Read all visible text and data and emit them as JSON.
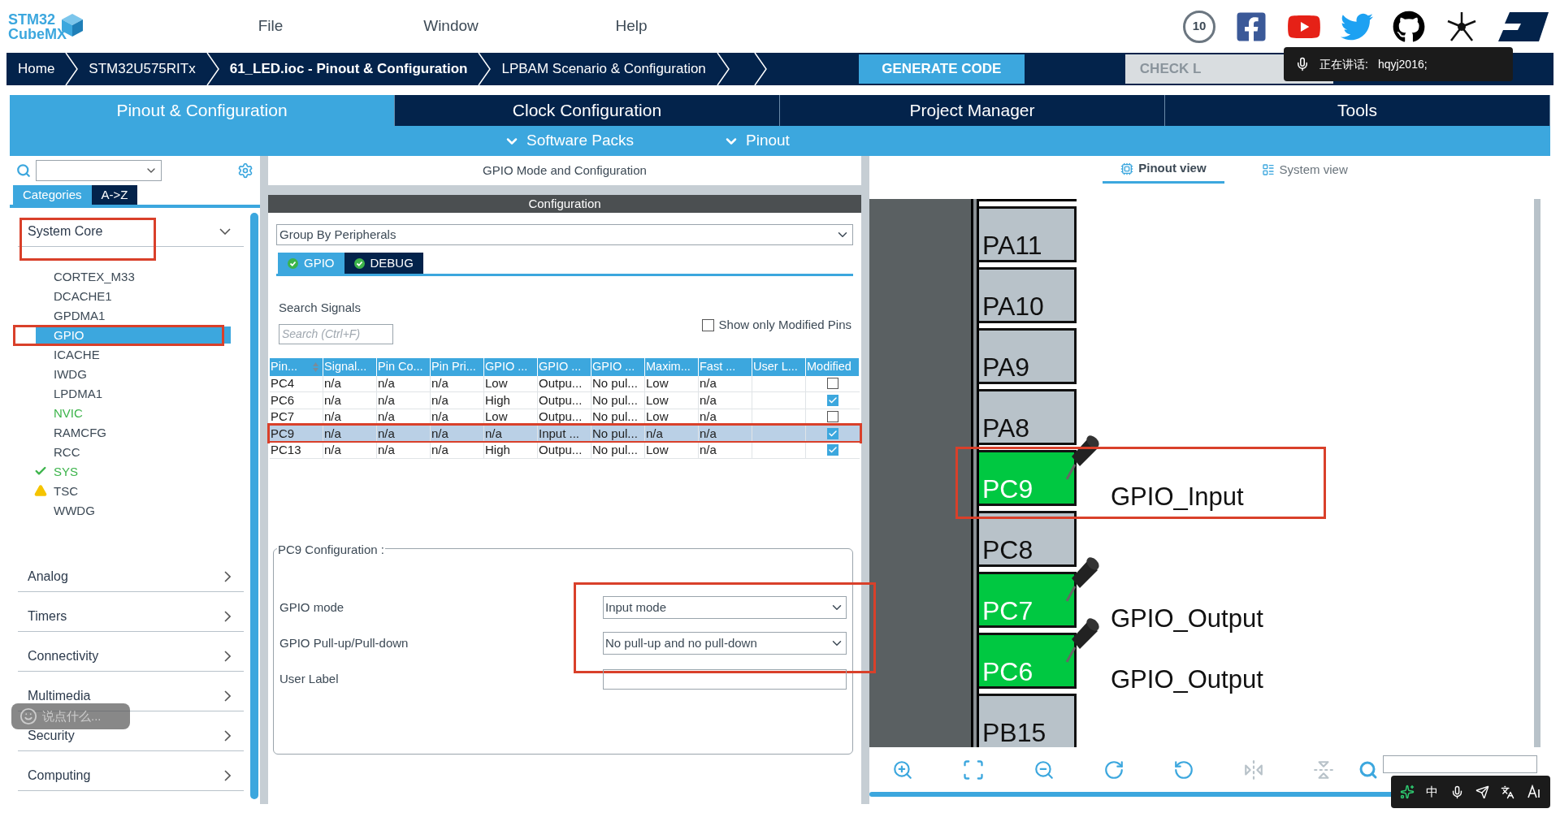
{
  "logo": {
    "line1": "STM32",
    "line2": "CubeMX"
  },
  "menu": [
    "File",
    "Window",
    "Help"
  ],
  "anniversary_badge": "10",
  "breadcrumbs": [
    {
      "label": "Home",
      "selected": false
    },
    {
      "label": "STM32U575RITx",
      "selected": false
    },
    {
      "label": "61_LED.ioc - Pinout & Configuration",
      "selected": true
    },
    {
      "label": "LPBAM Scenario & Configuration",
      "selected": false
    }
  ],
  "generate_button": "GENERATE CODE",
  "check_button": "CHECK L",
  "speaking_popup": {
    "label": "正在讲话:",
    "user": "hqyj2016;"
  },
  "main_tabs": [
    {
      "label": "Pinout & Configuration",
      "selected": true
    },
    {
      "label": "Clock Configuration",
      "selected": false
    },
    {
      "label": "Project Manager",
      "selected": false
    },
    {
      "label": "Tools",
      "selected": false
    }
  ],
  "sub_menus": [
    "Software Packs",
    "Pinout"
  ],
  "left_panel": {
    "tabs": [
      {
        "label": "Categories",
        "selected": true
      },
      {
        "label": "A->Z",
        "selected": false
      }
    ],
    "categories": [
      {
        "label": "System Core",
        "expanded": true,
        "highlighted": true,
        "children": [
          {
            "label": "CORTEX_M33",
            "kind": "plain",
            "selected": false,
            "highlighted": false
          },
          {
            "label": "DCACHE1",
            "kind": "plain",
            "selected": false,
            "highlighted": false
          },
          {
            "label": "GPDMA1",
            "kind": "plain",
            "selected": false,
            "highlighted": false
          },
          {
            "label": "GPIO",
            "kind": "plain",
            "selected": true,
            "highlighted": true
          },
          {
            "label": "ICACHE",
            "kind": "plain",
            "selected": false,
            "highlighted": false
          },
          {
            "label": "IWDG",
            "kind": "plain",
            "selected": false,
            "highlighted": false
          },
          {
            "label": "LPDMA1",
            "kind": "plain",
            "selected": false,
            "highlighted": false
          },
          {
            "label": "NVIC",
            "kind": "configured",
            "selected": false,
            "highlighted": false
          },
          {
            "label": "RAMCFG",
            "kind": "plain",
            "selected": false,
            "highlighted": false
          },
          {
            "label": "RCC",
            "kind": "plain",
            "selected": false,
            "highlighted": false
          },
          {
            "label": "SYS",
            "kind": "ok",
            "selected": false,
            "highlighted": false
          },
          {
            "label": "TSC",
            "kind": "warning",
            "selected": false,
            "highlighted": false
          },
          {
            "label": "WWDG",
            "kind": "plain",
            "selected": false,
            "highlighted": false
          }
        ]
      },
      {
        "label": "Analog",
        "expanded": false,
        "highlighted": false
      },
      {
        "label": "Timers",
        "expanded": false,
        "highlighted": false
      },
      {
        "label": "Connectivity",
        "expanded": false,
        "highlighted": false
      },
      {
        "label": "Multimedia",
        "expanded": false,
        "highlighted": false
      },
      {
        "label": "Security",
        "expanded": false,
        "highlighted": false
      },
      {
        "label": "Computing",
        "expanded": false,
        "highlighted": false
      }
    ]
  },
  "chat_bubble": {
    "placeholder": "说点什么..."
  },
  "middle_panel": {
    "title": "GPIO Mode and Configuration",
    "config_bar": "Configuration",
    "group_select": "Group By Peripherals",
    "tabs": [
      {
        "label": "GPIO",
        "selected": true
      },
      {
        "label": "DEBUG",
        "selected": false
      }
    ],
    "search_label": "Search Signals",
    "search": {
      "placeholder": "Search (Ctrl+F)"
    },
    "modified_only": {
      "label": "Show only Modified Pins",
      "checked": false
    },
    "table": {
      "columns": [
        {
          "label": "Pin...",
          "sorted": true
        },
        {
          "label": "Signal...",
          "sorted": false
        },
        {
          "label": "Pin Co...",
          "sorted": false
        },
        {
          "label": "Pin Pri...",
          "sorted": false
        },
        {
          "label": "GPIO ...",
          "sorted": false
        },
        {
          "label": "GPIO ...",
          "sorted": false
        },
        {
          "label": "GPIO ...",
          "sorted": false
        },
        {
          "label": "Maxim...",
          "sorted": false
        },
        {
          "label": "Fast ...",
          "sorted": false
        },
        {
          "label": "User L...",
          "sorted": false
        },
        {
          "label": "Modified",
          "sorted": false
        }
      ],
      "rows": [
        {
          "cells": [
            "PC4",
            "n/a",
            "n/a",
            "n/a",
            "Low",
            "Outpu...",
            "No pul...",
            "Low",
            "n/a",
            null
          ],
          "modified": false,
          "selected": false,
          "highlighted": false
        },
        {
          "cells": [
            "PC6",
            "n/a",
            "n/a",
            "n/a",
            "High",
            "Outpu...",
            "No pul...",
            "Low",
            "n/a",
            null
          ],
          "modified": true,
          "selected": false,
          "highlighted": false
        },
        {
          "cells": [
            "PC7",
            "n/a",
            "n/a",
            "n/a",
            "Low",
            "Outpu...",
            "No pul...",
            "Low",
            "n/a",
            null
          ],
          "modified": false,
          "selected": false,
          "highlighted": false
        },
        {
          "cells": [
            "PC9",
            "n/a",
            "n/a",
            "n/a",
            "n/a",
            "Input ...",
            "No pul...",
            "n/a",
            "n/a",
            null
          ],
          "modified": true,
          "selected": true,
          "highlighted": true
        },
        {
          "cells": [
            "PC13",
            "n/a",
            "n/a",
            "n/a",
            "High",
            "Outpu...",
            "No pul...",
            "Low",
            "n/a",
            null
          ],
          "modified": true,
          "selected": false,
          "highlighted": false
        }
      ]
    },
    "config": {
      "title": "PC9 Configuration :",
      "fields": [
        {
          "label": "GPIO mode",
          "kind": "select",
          "value": "Input mode",
          "highlighted": true
        },
        {
          "label": "GPIO Pull-up/Pull-down",
          "kind": "select",
          "value": "No pull-up and no pull-down",
          "highlighted": true
        },
        {
          "label": "User Label",
          "kind": "text",
          "highlighted": false
        }
      ]
    }
  },
  "right_panel": {
    "view_tabs": [
      {
        "label": "Pinout view",
        "selected": true
      },
      {
        "label": "System view",
        "selected": false
      }
    ],
    "pins": [
      {
        "label": "PA11",
        "active": false,
        "highlighted": false
      },
      {
        "label": "PA10",
        "active": false,
        "highlighted": false
      },
      {
        "label": "PA9",
        "active": false,
        "highlighted": false
      },
      {
        "label": "PA8",
        "active": false,
        "highlighted": false
      },
      {
        "label": "PC9",
        "active": true,
        "signal": "GPIO_Input",
        "highlighted": true
      },
      {
        "label": "PC8",
        "active": false,
        "highlighted": false
      },
      {
        "label": "PC7",
        "active": true,
        "signal": "GPIO_Output",
        "highlighted": false
      },
      {
        "label": "PC6",
        "active": true,
        "signal": "GPIO_Output",
        "highlighted": false
      },
      {
        "label": "PB15",
        "active": false,
        "highlighted": false
      }
    ]
  },
  "ime_toolbar": {
    "mode": "中"
  }
}
